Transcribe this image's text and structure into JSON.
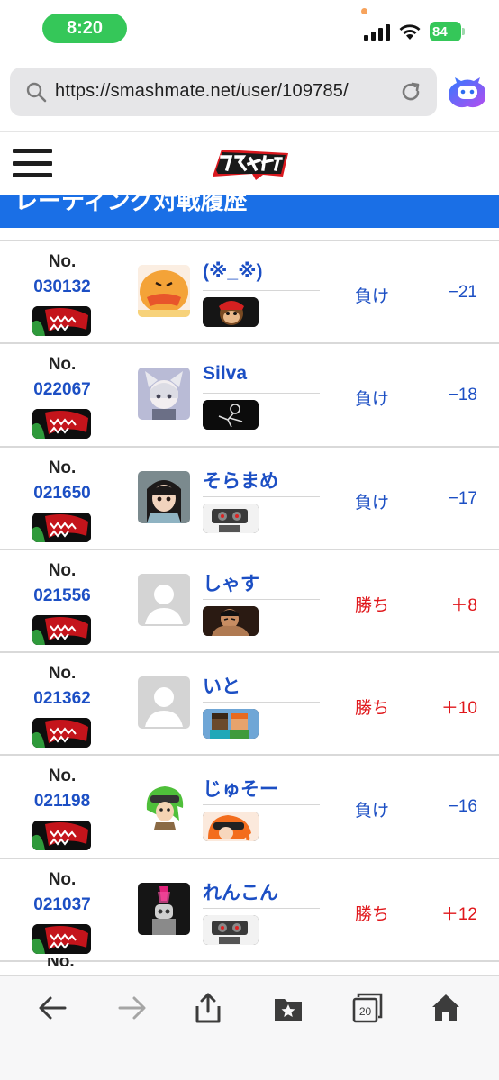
{
  "status_bar": {
    "time": "8:20",
    "battery_level": "84",
    "icons": [
      "cellular-signal-icon",
      "wifi-icon",
      "battery-charging-icon"
    ]
  },
  "browser": {
    "url": "https://smashmate.net/user/109785/",
    "icons": [
      "search-icon",
      "reload-icon",
      "assistant-icon"
    ]
  },
  "site": {
    "logo_text": "スマメイト",
    "section_title": "レーティング対戦履歴",
    "colors": {
      "banner": "#1a6fe6",
      "link_blue": "#1c4fc4",
      "win_red": "#e0161a"
    }
  },
  "history": {
    "no_label": "No.",
    "next_row_label": "No.",
    "rows": [
      {
        "match_id": "030132",
        "opponent": "(※_※)",
        "result": "負け",
        "result_type": "lose",
        "rating": "−21",
        "opponent_fighter": "diddy-kong",
        "avatar": "orange-bird"
      },
      {
        "match_id": "022067",
        "opponent": "Silva",
        "result": "負け",
        "result_type": "lose",
        "rating": "−18",
        "opponent_fighter": "game-and-watch",
        "avatar": "catgirl"
      },
      {
        "match_id": "021650",
        "opponent": "そらまめ",
        "result": "負け",
        "result_type": "lose",
        "rating": "−17",
        "opponent_fighter": "rob",
        "avatar": "anime-girl"
      },
      {
        "match_id": "021556",
        "opponent": "しゃす",
        "result": "勝ち",
        "result_type": "win",
        "rating": "＋8",
        "opponent_fighter": "kazuya",
        "avatar": "default"
      },
      {
        "match_id": "021362",
        "opponent": "いと",
        "result": "勝ち",
        "result_type": "win",
        "rating": "＋10",
        "opponent_fighter": "steve",
        "avatar": "default"
      },
      {
        "match_id": "021198",
        "opponent": "じゅそー",
        "result": "負け",
        "result_type": "lose",
        "rating": "−16",
        "opponent_fighter": "inkling",
        "avatar": "inkling"
      },
      {
        "match_id": "021037",
        "opponent": "れんこん",
        "result": "勝ち",
        "result_type": "win",
        "rating": "＋12",
        "opponent_fighter": "rob",
        "avatar": "robot-pink"
      }
    ],
    "own_fighter": "piranha-plant"
  },
  "toolbar": {
    "tabs_count": "20",
    "icons": [
      "back-icon",
      "forward-icon",
      "share-icon",
      "bookmarks-icon",
      "tabs-icon",
      "home-icon"
    ]
  }
}
